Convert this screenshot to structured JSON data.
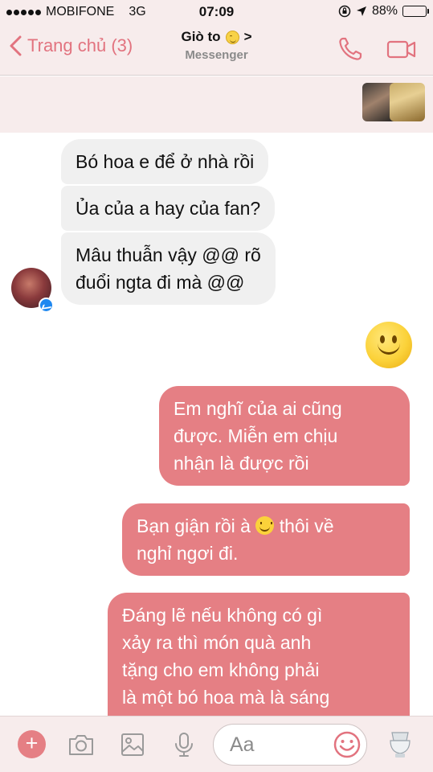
{
  "status_bar": {
    "carrier": "MOBIFONE",
    "network": "3G",
    "time": "07:09",
    "battery": "88%",
    "battery_level": 0.88
  },
  "nav": {
    "back_label": "Trang chủ (3)",
    "title": "Giò to",
    "subtitle": "Messenger"
  },
  "messages": [
    {
      "side": "in",
      "text": "Bó hoa e để ở nhà rồi"
    },
    {
      "side": "in",
      "text": "Ủa của a hay của fan?"
    },
    {
      "side": "in",
      "line1": "Mâu thuẫn vậy @@ rõ",
      "line2": "đuổi ngta đi mà @@"
    },
    {
      "side": "out",
      "line1": "Em nghĩ của ai cũng",
      "line2": "được. Miễn em chịu",
      "line3": "nhận là được rồi"
    },
    {
      "side": "out",
      "line1_a": "Bạn giận rồi à",
      "line1_b": "thôi về",
      "line2": "nghỉ ngơi đi."
    },
    {
      "side": "out",
      "line1": "Đáng lẽ nếu không có gì",
      "line2": "xảy ra thì món quà anh",
      "line3": "tặng cho em không phải",
      "line4": "là một bó hoa mà là sáng"
    }
  ],
  "composer": {
    "placeholder": "Aa"
  },
  "colors": {
    "accent": "#e2737f",
    "outgoing_bubble": "#e57f84",
    "incoming_bubble": "#f0f0f0",
    "header_bg": "#f7ecec"
  },
  "icons": [
    "back-chevron-icon",
    "phone-icon",
    "video-camera-icon",
    "plus-icon",
    "camera-icon",
    "image-icon",
    "microphone-icon",
    "emoji-icon",
    "sticker-icon",
    "smiley-emoji",
    "messenger-badge-icon"
  ]
}
